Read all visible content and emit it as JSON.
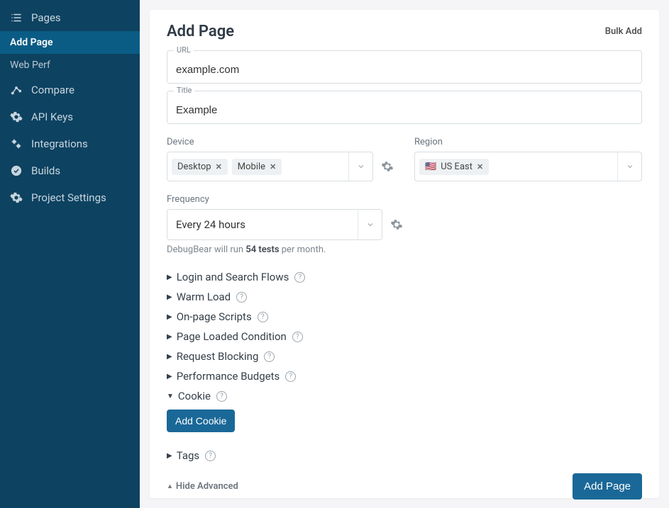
{
  "sidebar": {
    "items": [
      {
        "label": "Pages"
      },
      {
        "label": "Compare"
      },
      {
        "label": "API Keys"
      },
      {
        "label": "Integrations"
      },
      {
        "label": "Builds"
      },
      {
        "label": "Project Settings"
      }
    ],
    "subitems": [
      {
        "label": "Add Page"
      },
      {
        "label": "Web Perf"
      }
    ]
  },
  "header": {
    "title": "Add Page",
    "bulk_link": "Bulk Add"
  },
  "fields": {
    "url": {
      "label": "URL",
      "value": "example.com"
    },
    "title": {
      "label": "Title",
      "value": "Example"
    },
    "device": {
      "label": "Device",
      "chips": [
        "Desktop",
        "Mobile"
      ]
    },
    "region": {
      "label": "Region",
      "chips": [
        "US East"
      ],
      "flag": "🇺🇸"
    },
    "frequency": {
      "label": "Frequency",
      "value": "Every 24 hours"
    },
    "hint_prefix": "DebugBear will run ",
    "hint_count": "54 tests",
    "hint_suffix": " per month."
  },
  "advanced": {
    "sections": [
      "Login and Search Flows",
      "Warm Load",
      "On-page Scripts",
      "Page Loaded Condition",
      "Request Blocking",
      "Performance Budgets"
    ],
    "cookie_section": "Cookie",
    "add_cookie": "Add Cookie",
    "tags_section": "Tags",
    "hide_label": "Hide Advanced"
  },
  "footer": {
    "submit": "Add Page"
  }
}
